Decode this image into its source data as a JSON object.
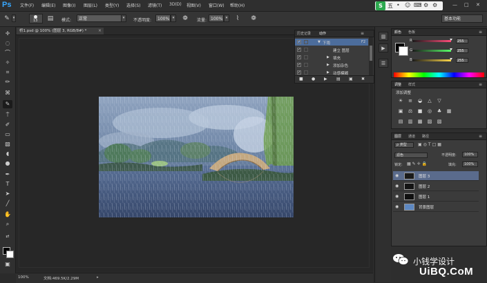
{
  "menubar": {
    "logo": "Ps",
    "items": [
      "文件(F)",
      "编辑(E)",
      "图像(I)",
      "图层(L)",
      "类型(Y)",
      "选择(S)",
      "滤镜(T)",
      "3D(D)",
      "视图(V)",
      "窗口(W)",
      "帮助(H)"
    ],
    "ime": {
      "badge": "S",
      "mode": "五",
      "glyphs": [
        "•",
        "☺",
        "⌨",
        "⚙",
        "⚙"
      ]
    },
    "window_controls": [
      "—",
      "□",
      "✕"
    ]
  },
  "options": {
    "brush_size": "13",
    "mode_label": "模式:",
    "mode_value": "正常",
    "opacity_label": "不透明度:",
    "opacity_value": "100%",
    "flow_label": "流量:",
    "flow_value": "100%",
    "workspace": "基本功能"
  },
  "document": {
    "tab_title": "桥1.psd @ 100% (图层 3, RGB/8#) *",
    "tab_close": "×"
  },
  "status": {
    "zoom": "100%",
    "doc_info": "文档:469.5K/2.29M"
  },
  "actions_panel": {
    "tabs": [
      "历史记录",
      "动作"
    ],
    "rows": [
      {
        "check": true,
        "expand": "▼",
        "label": "下雨",
        "key": "F2",
        "selected": true
      },
      {
        "check": true,
        "expand": "",
        "label": "建立 图层",
        "key": ""
      },
      {
        "check": true,
        "expand": "▶",
        "label": "填充",
        "key": ""
      },
      {
        "check": true,
        "expand": "▶",
        "label": "添加杂色",
        "key": ""
      },
      {
        "check": true,
        "expand": "▶",
        "label": "动感模糊",
        "key": ""
      }
    ]
  },
  "color_panel": {
    "tabs": [
      "颜色",
      "色板"
    ],
    "channels": [
      {
        "name": "R",
        "value": "255",
        "color": "#ff4d7a"
      },
      {
        "name": "G",
        "value": "255",
        "color": "#5aff6a"
      },
      {
        "name": "B",
        "value": "255",
        "color": "#ffd84a"
      }
    ]
  },
  "adjust_panel": {
    "tabs": [
      "调整",
      "样式"
    ],
    "title": "添加调整",
    "icons_row1": [
      "☀",
      "≡",
      "◒",
      "△",
      "▽"
    ],
    "icons_row2": [
      "▣",
      "⚖",
      "■",
      "◎",
      "♣",
      "▦"
    ],
    "icons_row3": [
      "▤",
      "▥",
      "▩",
      "▨",
      "▧"
    ]
  },
  "layers_panel": {
    "tabs": [
      "图层",
      "通道",
      "路径"
    ],
    "kind": "ρ 类型",
    "blend": "滤色",
    "opacity_label": "不透明度:",
    "opacity": "100%",
    "lock_label": "锁定:",
    "fill_label": "填充:",
    "fill": "100%",
    "layers": [
      {
        "name": "图层 3",
        "selected": true,
        "thumb": "#1a1a1a"
      },
      {
        "name": "图层 2",
        "selected": false,
        "thumb": "#141414"
      },
      {
        "name": "图层 1",
        "selected": false,
        "thumb": "#101010"
      },
      {
        "name": "背景图层",
        "selected": false,
        "thumb": "#5d88c2"
      }
    ]
  },
  "watermark": {
    "name": "小钱学设计",
    "site": "UiBQ.CoM"
  }
}
